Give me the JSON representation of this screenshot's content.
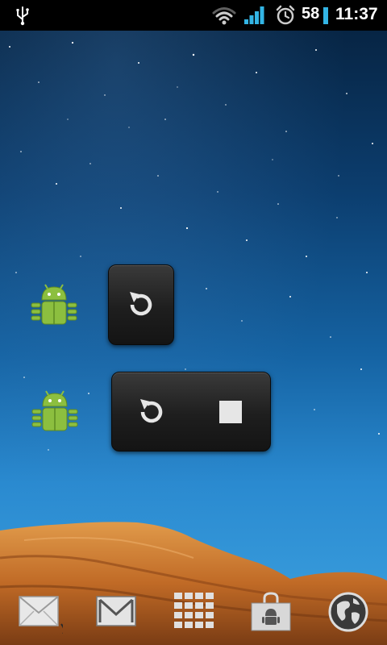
{
  "status_bar": {
    "icons": [
      "usb-icon",
      "wifi-icon",
      "signal-icon",
      "alarm-icon"
    ],
    "battery_level": "58",
    "time": "11:37",
    "accent_color": "#33b5e5"
  },
  "home": {
    "shortcuts": [
      {
        "icon": "android-robot-icon"
      },
      {
        "icon": "android-robot-icon"
      }
    ],
    "widgets": [
      {
        "buttons": [
          "restart-icon"
        ]
      },
      {
        "buttons": [
          "restart-icon",
          "stop-icon"
        ]
      }
    ]
  },
  "dock": {
    "items": [
      "email-icon",
      "gmail-icon",
      "app-drawer-icon",
      "market-icon",
      "browser-icon"
    ]
  }
}
